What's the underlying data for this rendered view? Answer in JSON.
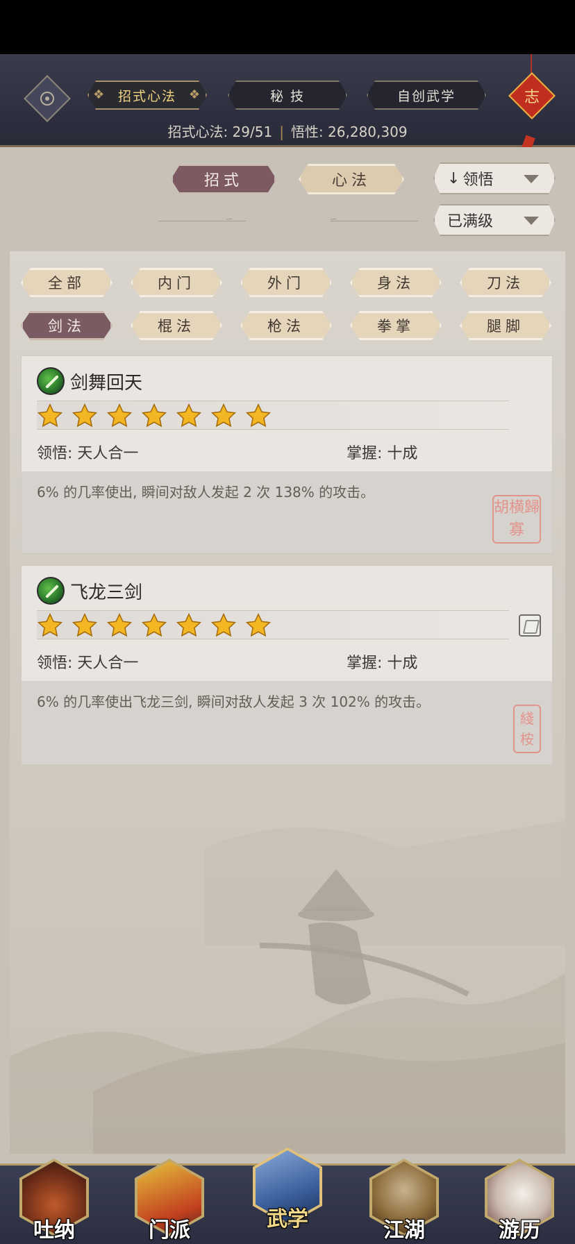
{
  "header": {
    "tabs": [
      {
        "label": "招式心法",
        "active": true
      },
      {
        "label": "秘 技",
        "active": false
      },
      {
        "label": "自创武学",
        "active": false
      }
    ],
    "badge_char": "志",
    "stats": {
      "moves_label": "招式心法: 29/51",
      "insight_label": "悟性: 26,280,309"
    }
  },
  "mode_tabs": [
    {
      "label": "招式",
      "active": true
    },
    {
      "label": "心法",
      "active": false
    }
  ],
  "dropdowns": {
    "sort": "领悟",
    "level": "已满级"
  },
  "filters": {
    "row1": [
      "全部",
      "内门",
      "外门",
      "身法",
      "刀法"
    ],
    "row2": [
      "剑法",
      "棍法",
      "枪法",
      "拳掌",
      "腿脚"
    ],
    "active": "剑法"
  },
  "skills": [
    {
      "name": "剑舞回天",
      "stars": 7,
      "comprehension": "领悟: 天人合一",
      "mastery": "掌握: 十成",
      "description": "6% 的几率使出, 瞬间对敌人发起 2 次 138% 的攻击。",
      "seal": "胡横歸寡"
    },
    {
      "name": "飞龙三剑",
      "stars": 7,
      "comprehension": "领悟: 天人合一",
      "mastery": "掌握: 十成",
      "description": "6% 的几率使出飞龙三剑, 瞬间对敌人发起 3 次 102% 的攻击。",
      "seal": "綫桉"
    }
  ],
  "bottom_nav": [
    {
      "label": "吐纳",
      "icon": "meditation-icon",
      "active": false
    },
    {
      "label": "门派",
      "icon": "sect-flag-icon",
      "active": false
    },
    {
      "label": "武学",
      "icon": "martial-book-icon",
      "active": true
    },
    {
      "label": "江湖",
      "icon": "bamboo-hat-icon",
      "active": false
    },
    {
      "label": "游历",
      "icon": "horse-icon",
      "active": false
    }
  ],
  "colors": {
    "accent_dark": "#7d5a62",
    "accent_light": "#dccbae",
    "star": "#f3b723",
    "header_bg": "#2f3040"
  }
}
